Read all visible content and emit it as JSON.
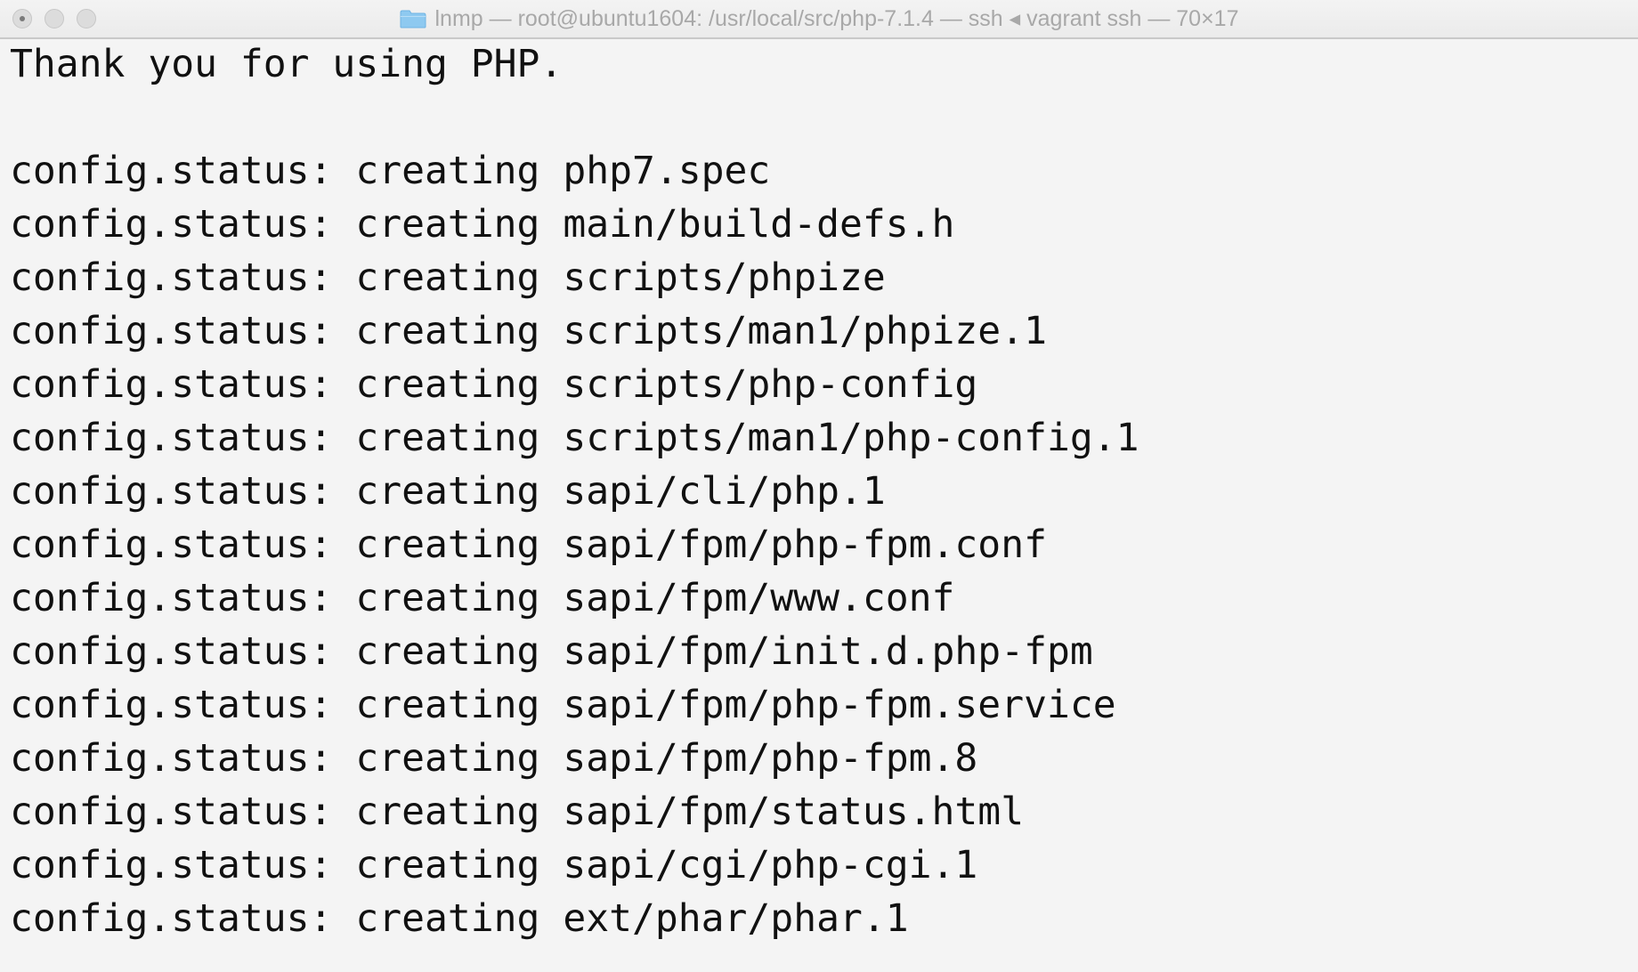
{
  "window": {
    "title": "lnmp — root@ubuntu1604: /usr/local/src/php-7.1.4 — ssh ◂ vagrant ssh — 70×17",
    "folder_icon": "folder-icon",
    "traffic_lights": [
      "close",
      "minimize",
      "zoom"
    ]
  },
  "terminal": {
    "lines": [
      "Thank you for using PHP.",
      "",
      "config.status: creating php7.spec",
      "config.status: creating main/build-defs.h",
      "config.status: creating scripts/phpize",
      "config.status: creating scripts/man1/phpize.1",
      "config.status: creating scripts/php-config",
      "config.status: creating scripts/man1/php-config.1",
      "config.status: creating sapi/cli/php.1",
      "config.status: creating sapi/fpm/php-fpm.conf",
      "config.status: creating sapi/fpm/www.conf",
      "config.status: creating sapi/fpm/init.d.php-fpm",
      "config.status: creating sapi/fpm/php-fpm.service",
      "config.status: creating sapi/fpm/php-fpm.8",
      "config.status: creating sapi/fpm/status.html",
      "config.status: creating sapi/cgi/php-cgi.1",
      "config.status: creating ext/phar/phar.1"
    ]
  },
  "colors": {
    "background": "#f4f4f4",
    "text": "#111111",
    "title_text": "#a8a8a8",
    "folder": "#8ec9f0"
  }
}
